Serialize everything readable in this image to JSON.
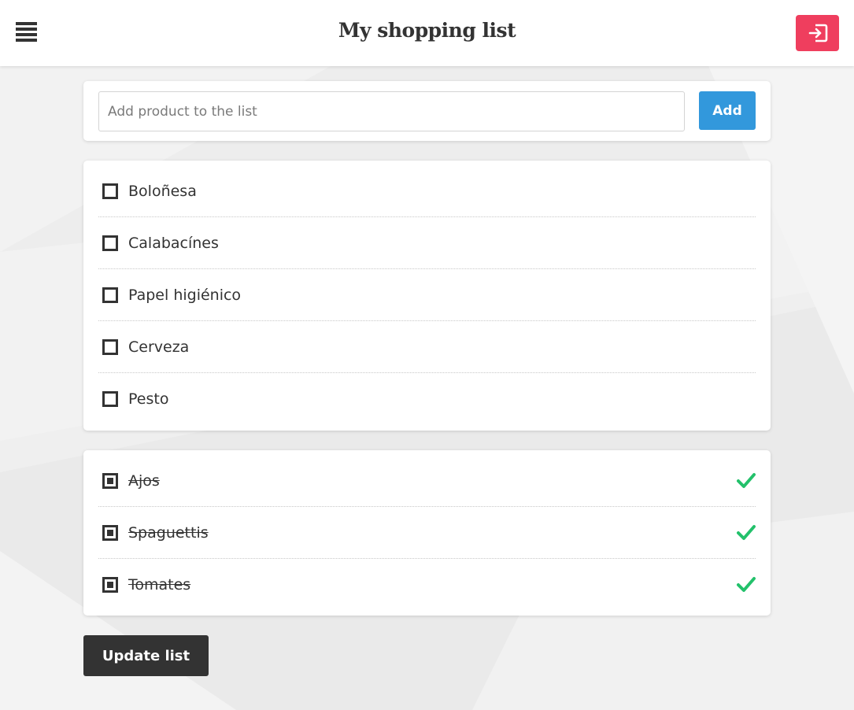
{
  "header": {
    "title": "My shopping list",
    "menu_icon": "hamburger-menu-icon",
    "logout_icon": "logout-icon",
    "logout_color": "#ef3e5e"
  },
  "add_form": {
    "placeholder": "Add product to the list",
    "value": "",
    "button_label": "Add",
    "button_color": "#3298dc"
  },
  "pending_items": [
    {
      "label": "Boloñesa",
      "checked": false
    },
    {
      "label": "Calabacínes",
      "checked": false
    },
    {
      "label": "Papel higiénico",
      "checked": false
    },
    {
      "label": "Cerveza",
      "checked": false
    },
    {
      "label": "Pesto",
      "checked": false
    }
  ],
  "done_items": [
    {
      "label": "Ajos",
      "checked": true,
      "status_icon": "checkmark-icon"
    },
    {
      "label": "Spaguettis",
      "checked": true,
      "status_icon": "checkmark-icon"
    },
    {
      "label": "Tomates",
      "checked": true,
      "status_icon": "checkmark-icon"
    }
  ],
  "done_check_color": "#23c16b",
  "update_button": {
    "label": "Update list"
  }
}
